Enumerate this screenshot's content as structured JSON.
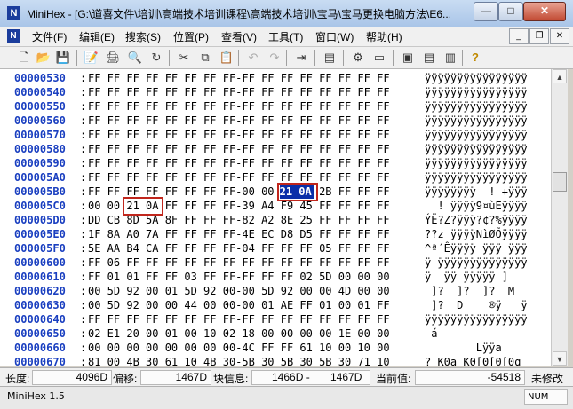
{
  "window": {
    "app_letter": "N",
    "title": "MiniHex - [G:\\道喜文件\\培训\\高端技术培训课程\\高端技术培训\\宝马\\宝马更换电脑方法\\E6...",
    "minimize": "—",
    "maximize": "□",
    "close": "✕"
  },
  "menu": {
    "doc_letter": "N",
    "items": [
      "文件(F)",
      "编辑(E)",
      "搜索(S)",
      "位置(P)",
      "查看(V)",
      "工具(T)",
      "窗口(W)",
      "帮助(H)"
    ],
    "mdi_minimize": "_",
    "mdi_restore": "❐",
    "mdi_close": "✕"
  },
  "toolbar": {
    "new": "🗋",
    "open": "📂",
    "save": "💾",
    "properties": "📝",
    "print": "🖨",
    "find": "🔍",
    "refresh": "↻",
    "cut": "✂",
    "copy": "⧉",
    "paste": "📋",
    "undo": "↶",
    "redo": "↷",
    "goto": "⇥",
    "calc": "▤",
    "tool1": "⚙",
    "tool2": "▭",
    "win1": "▣",
    "win2": "▤",
    "win3": "▥",
    "help": "?"
  },
  "hex_rows": [
    {
      "addr": "00000530",
      "hex": "FF FF FF FF FF FF FF FF-FF FF FF FF FF FF FF FF",
      "ascii": "ÿÿÿÿÿÿÿÿÿÿÿÿÿÿÿÿ"
    },
    {
      "addr": "00000540",
      "hex": "FF FF FF FF FF FF FF FF-FF FF FF FF FF FF FF FF",
      "ascii": "ÿÿÿÿÿÿÿÿÿÿÿÿÿÿÿÿ"
    },
    {
      "addr": "00000550",
      "hex": "FF FF FF FF FF FF FF FF-FF FF FF FF FF FF FF FF",
      "ascii": "ÿÿÿÿÿÿÿÿÿÿÿÿÿÿÿÿ"
    },
    {
      "addr": "00000560",
      "hex": "FF FF FF FF FF FF FF FF-FF FF FF FF FF FF FF FF",
      "ascii": "ÿÿÿÿÿÿÿÿÿÿÿÿÿÿÿÿ"
    },
    {
      "addr": "00000570",
      "hex": "FF FF FF FF FF FF FF FF-FF FF FF FF FF FF FF FF",
      "ascii": "ÿÿÿÿÿÿÿÿÿÿÿÿÿÿÿÿ"
    },
    {
      "addr": "00000580",
      "hex": "FF FF FF FF FF FF FF FF-FF FF FF FF FF FF FF FF",
      "ascii": "ÿÿÿÿÿÿÿÿÿÿÿÿÿÿÿÿ"
    },
    {
      "addr": "00000590",
      "hex": "FF FF FF FF FF FF FF FF-FF FF FF FF FF FF FF FF",
      "ascii": "ÿÿÿÿÿÿÿÿÿÿÿÿÿÿÿÿ"
    },
    {
      "addr": "000005A0",
      "hex": "FF FF FF FF FF FF FF FF-FF FF FF FF FF FF FF FF",
      "ascii": "ÿÿÿÿÿÿÿÿÿÿÿÿÿÿÿÿ"
    },
    {
      "addr": "000005B0",
      "hex": "FF FF FF FF FF FF FF FF-00 00 21 0A 2B FF FF FF",
      "ascii": "ÿÿÿÿÿÿÿÿ  ! +ÿÿÿ"
    },
    {
      "addr": "000005C0",
      "hex": "00 00 21 0A FF FF FF FF-39 A4 F9 45 FF FF FF FF",
      "ascii": "  ! ÿÿÿÿ9¤ùEÿÿÿÿ"
    },
    {
      "addr": "000005D0",
      "hex": "DD CB 8D 5A 8F FF FF FF-82 A2 8E 25 FF FF FF FF",
      "ascii": "ÝË?Z?ÿÿÿ?¢?%ÿÿÿÿ"
    },
    {
      "addr": "000005E0",
      "hex": "1F 8A A0 7A FF FF FF FF-4E EC D8 D5 FF FF FF FF",
      "ascii": "??z ÿÿÿÿNìØÕÿÿÿÿ"
    },
    {
      "addr": "000005F0",
      "hex": "5E AA B4 CA FF FF FF FF-04 FF FF FF 05 FF FF FF",
      "ascii": "^ª´Êÿÿÿÿ ÿÿÿ ÿÿÿ"
    },
    {
      "addr": "00000600",
      "hex": "FF 06 FF FF FF FF FF FF-FF FF FF FF FF FF FF FF",
      "ascii": "ÿ ÿÿÿÿÿÿÿÿÿÿÿÿÿÿ"
    },
    {
      "addr": "00000610",
      "hex": "FF 01 01 FF FF 03 FF FF-FF FF FF 02 5D 00 00 00",
      "ascii": "ÿ  ÿÿ ÿÿÿÿÿ ]   "
    },
    {
      "addr": "00000620",
      "hex": "00 5D 92 00 01 5D 92 00-00 5D 92 00 00 4D 00 00",
      "ascii": " ]?  ]?  ]?  M  "
    },
    {
      "addr": "00000630",
      "hex": "00 5D 92 00 00 44 00 00-00 01 AE FF 01 00 01 FF",
      "ascii": " ]?  D    ®ÿ   ÿ"
    },
    {
      "addr": "00000640",
      "hex": "FF FF FF FF FF FF FF FF-FF FF FF FF FF FF FF FF",
      "ascii": "ÿÿÿÿÿÿÿÿÿÿÿÿÿÿÿÿ"
    },
    {
      "addr": "00000650",
      "hex": "02 E1 20 00 01 00 10 02-18 00 00 00 00 1E 00 00",
      "ascii": " á              "
    },
    {
      "addr": "00000660",
      "hex": "00 00 00 00 00 00 00 00-4C FF FF 61 10 00 10 00",
      "ascii": "        Lÿÿa    "
    },
    {
      "addr": "00000670",
      "hex": "81 00 4B 30 61 10 4B 30-5B 30 5B 30 5B 30 71 10",
      "ascii": "? K0a K0[0[0[0q "
    }
  ],
  "status": {
    "length_label": "长度:",
    "length_value": "4096D",
    "offset_label": "偏移:",
    "offset_value": "1467D",
    "block_label": "块信息:",
    "block_start": "1466D -",
    "block_end": "1467D",
    "current_label": "当前值:",
    "current_value": "-54518",
    "modified": "未修改"
  },
  "status2": {
    "app": "MiniHex 1.5",
    "num": "NUM"
  },
  "colors": {
    "address": "#1a3fc0",
    "highlight": "#0a2fa8",
    "redbox": "#c0261c"
  }
}
